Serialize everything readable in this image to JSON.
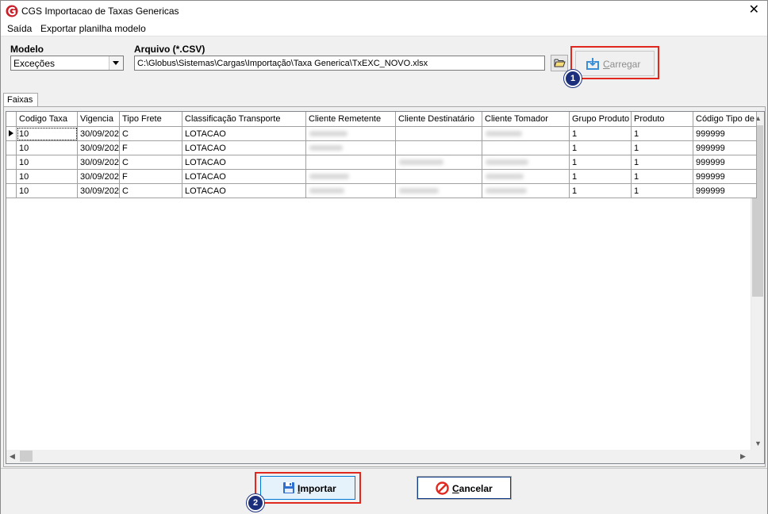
{
  "window": {
    "title": "CGS Importacao de Taxas Genericas"
  },
  "menu": {
    "items": [
      "Saída",
      "Exportar planilha modelo"
    ]
  },
  "form": {
    "modelo_label": "Modelo",
    "modelo_value": "Exceções",
    "arquivo_label": "Arquivo (*.CSV)",
    "arquivo_value": "C:\\Globus\\Sistemas\\Cargas\\Importação\\Taxa Generica\\TxEXC_NOVO.xlsx",
    "carregar_label": "Carregar"
  },
  "callouts": {
    "one": "1",
    "two": "2"
  },
  "tabs": {
    "faixas": "Faixas"
  },
  "grid": {
    "columns": [
      "Codigo Taxa",
      "Vigencia",
      "Tipo Frete",
      "Classificação Transporte",
      "Cliente Remetente",
      "Cliente Destinatário",
      "Cliente Tomador",
      "Grupo Produto",
      "Produto",
      "Código Tipo de"
    ],
    "rows": [
      [
        "10",
        "30/09/202",
        "C",
        "LOTACAO",
        "",
        "",
        "",
        "1",
        "1",
        "999999"
      ],
      [
        "10",
        "30/09/202",
        "F",
        "LOTACAO",
        "",
        "",
        "",
        "1",
        "1",
        "999999"
      ],
      [
        "10",
        "30/09/202",
        "C",
        "LOTACAO",
        "",
        "",
        "",
        "1",
        "1",
        "999999"
      ],
      [
        "10",
        "30/09/202",
        "F",
        "LOTACAO",
        "",
        "",
        "",
        "1",
        "1",
        "999999"
      ],
      [
        "10",
        "30/09/202",
        "C",
        "LOTACAO",
        "",
        "",
        "",
        "1",
        "1",
        "999999"
      ]
    ]
  },
  "buttons": {
    "importar": "Importar",
    "cancelar": "Cancelar"
  },
  "colors": {
    "callout_border": "#e0281e",
    "badge": "#1b2f7d",
    "focus_border": "#0078d7"
  }
}
